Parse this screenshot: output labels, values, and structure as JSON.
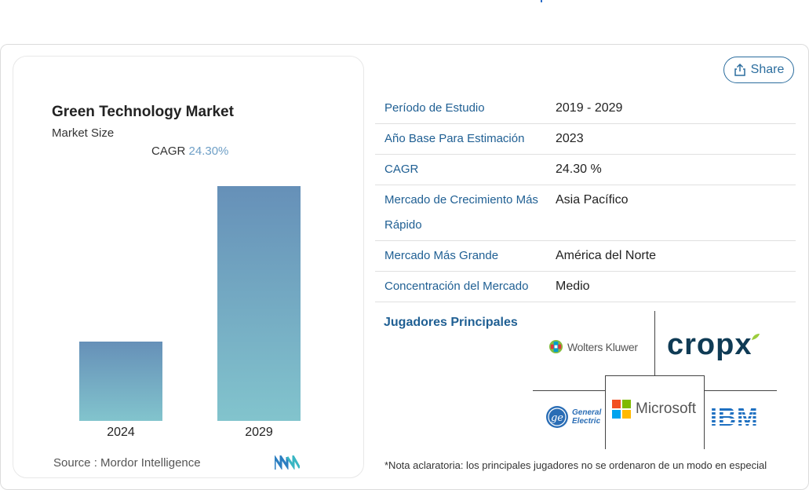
{
  "chart": {
    "title": "Green Technology Market",
    "subtitle": "Market Size",
    "cagr_label": "CAGR",
    "cagr_value": "24.30%",
    "source_label": "Source :",
    "source_value": "Mordor Intelligence"
  },
  "chart_data": {
    "type": "bar",
    "categories": [
      "2024",
      "2029"
    ],
    "values": [
      1,
      2.97
    ],
    "title": "Green Technology Market",
    "subtitle": "Market Size",
    "xlabel": "",
    "ylabel": "",
    "ylim": [
      0,
      3
    ]
  },
  "share": {
    "label": "Share"
  },
  "info_rows": [
    {
      "key": "Período de Estudio",
      "value": "2019 - 2029"
    },
    {
      "key": "Año Base Para Estimación",
      "value": "2023"
    },
    {
      "key": "CAGR",
      "value": "24.30 %"
    },
    {
      "key": "Mercado de Crecimiento Más Rápido",
      "value": "Asia Pacífico"
    },
    {
      "key": "Mercado Más Grande",
      "value": "América del Norte"
    },
    {
      "key": "Concentración del Mercado",
      "value": "Medio"
    }
  ],
  "players": {
    "label": "Jugadores Principales",
    "logos": [
      "Wolters Kluwer",
      "cropx",
      "General Electric",
      "Microsoft",
      "IBM"
    ]
  },
  "note": "*Nota aclaratoria: los principales jugadores no se ordenaron de un modo en especial",
  "colors": {
    "accent": "#1f5f93",
    "bar_top": "#6690b8",
    "bar_bottom": "#82c4cd"
  }
}
